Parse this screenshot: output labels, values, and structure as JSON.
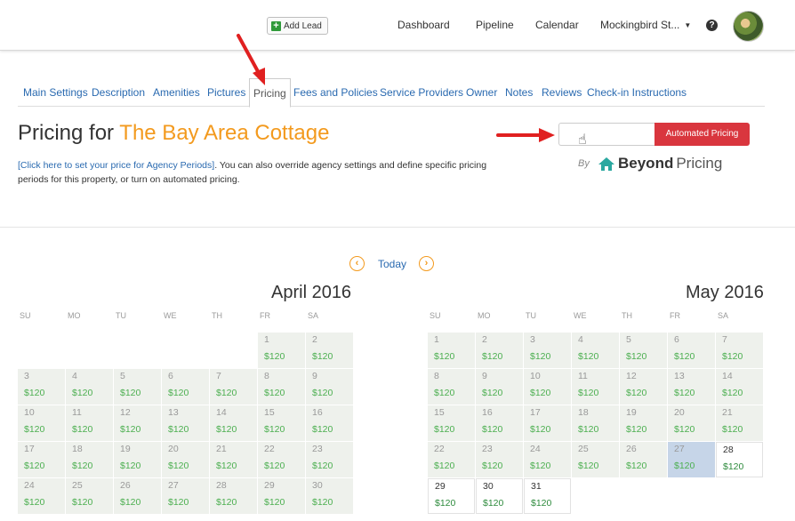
{
  "topnav": {
    "add_lead": "Add Lead",
    "dashboard": "Dashboard",
    "pipeline": "Pipeline",
    "calendar": "Calendar",
    "account": "Mockingbird St...",
    "help": "?"
  },
  "tabs": [
    {
      "label": "Main Settings"
    },
    {
      "label": "Description"
    },
    {
      "label": "Amenities"
    },
    {
      "label": "Pictures"
    },
    {
      "label": "Pricing",
      "active": true
    },
    {
      "label": "Fees and Policies"
    },
    {
      "label": "Service Providers"
    },
    {
      "label": "Owner"
    },
    {
      "label": "Notes"
    },
    {
      "label": "Reviews"
    },
    {
      "label": "Check-in Instructions"
    }
  ],
  "heading": {
    "prefix": "Pricing for ",
    "property": "The Bay Area Cottage"
  },
  "description": {
    "link": "[Click here to set your price for Agency Periods]",
    "text": ". You can also override agency settings and define specific pricing periods for this property, or turn on automated pricing."
  },
  "automated_pricing": {
    "button": "Automated Pricing",
    "by": "By",
    "brand_bold": "Beyond",
    "brand_rest": "Pricing"
  },
  "calendar_nav": {
    "today": "Today"
  },
  "weekdays": [
    "SU",
    "MO",
    "TU",
    "WE",
    "TH",
    "FR",
    "SA"
  ],
  "months": [
    {
      "title": "April 2016",
      "first_weekday": 5,
      "days": 30,
      "price": "$120",
      "white_days": [],
      "selected_days": []
    },
    {
      "title": "May 2016",
      "first_weekday": 0,
      "days": 31,
      "price": "$120",
      "white_days": [
        28,
        29,
        30,
        31
      ],
      "selected_days": [
        27
      ]
    }
  ],
  "colors": {
    "accent_orange": "#f39a1e",
    "link_blue": "#2a6ab0",
    "button_red": "#d9363e",
    "price_green": "#4caf50",
    "arrow_red": "#e02020"
  }
}
